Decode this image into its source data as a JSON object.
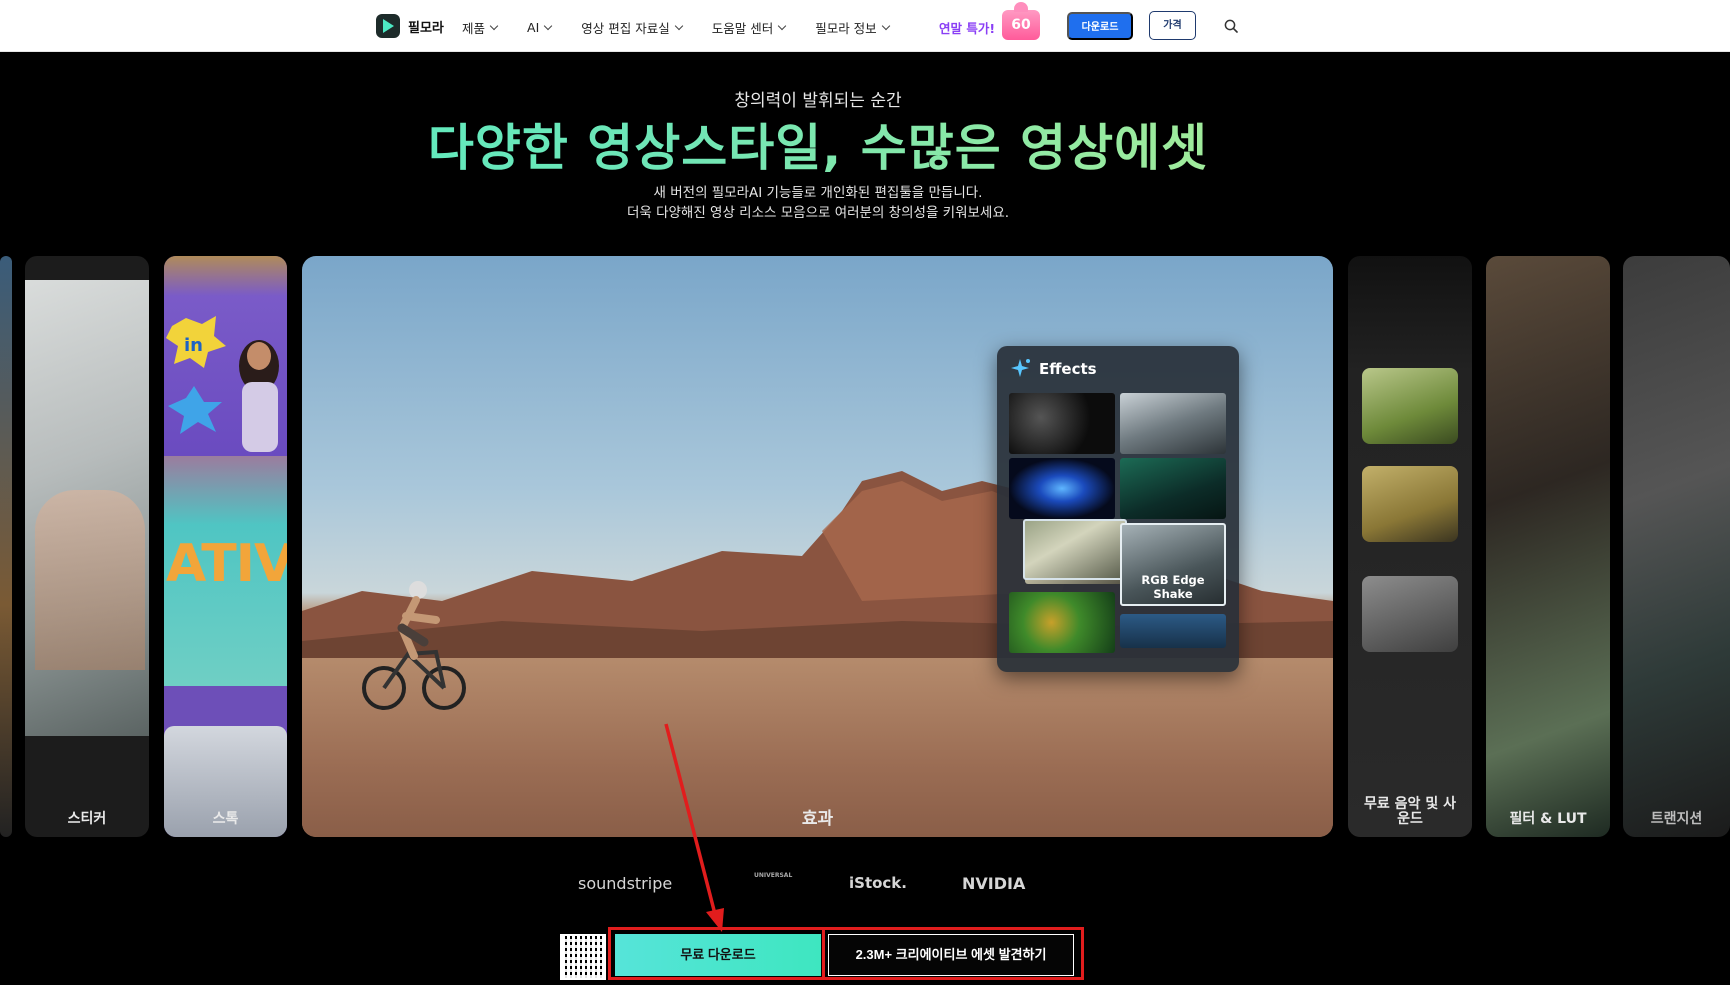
{
  "nav": {
    "brand": "필모라",
    "menu": [
      "제품",
      "AI",
      "영상 편집 자료실",
      "도움말 센터",
      "필모라 정보"
    ],
    "promo": "연말 특가!",
    "promo_badge": "60",
    "download_label": "다운로드",
    "price_label": "가격",
    "icons": {
      "search": "search-icon",
      "brand": "filmora-logo-icon"
    }
  },
  "hero": {
    "eyebrow": "창의력이 발휘되는 순간",
    "headline": "다양한 영상스타일, 수많은 영상에셋",
    "sub_line1": "새 버전의 필모라AI 기능들로 개인화된 편집툴을 만듭니다.",
    "sub_line2": "더욱 다양해진 영상 리소스 모음으로 여러분의 창의성을 키워보세요."
  },
  "carousel": {
    "cards": [
      {
        "label": "스티커"
      },
      {
        "label": "스톡"
      },
      {
        "label": "효과"
      },
      {
        "label": "무료 음악 및 사운드"
      },
      {
        "label": "필터 & LUT"
      },
      {
        "label": "트랜지션"
      }
    ],
    "active_index": 2
  },
  "effects_panel": {
    "title": "Effects",
    "highlight_caption": "RGB Edge Shake"
  },
  "card_text": {
    "ativ": "ATIV",
    "in": "in"
  },
  "partners": [
    "soundstripe",
    "UNIVERSAL",
    "iStock.",
    "NVIDIA"
  ],
  "cta": {
    "primary": "무료 다운로드",
    "secondary": "2.3M+ 크리에이티브 에셋 발견하기"
  },
  "colors": {
    "accent": "#3ee6c0",
    "brand_blue": "#1f6fee",
    "annotation_red": "#e11d1d",
    "promo_purple": "#8a3ff5"
  }
}
